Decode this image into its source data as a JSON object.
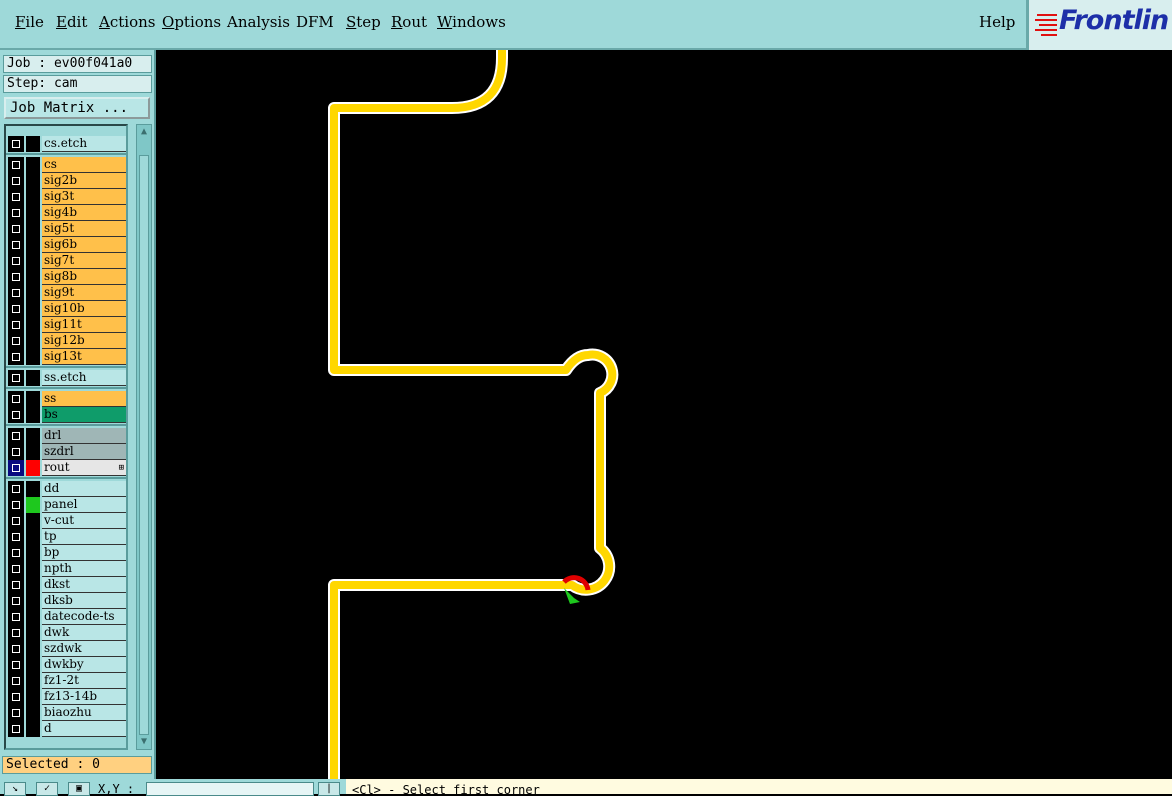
{
  "menubar": {
    "items": [
      "File",
      "Edit",
      "Actions",
      "Options",
      "Analysis",
      "DFM",
      "Step",
      "Rout",
      "Windows"
    ],
    "underline": [
      "F",
      "E",
      "A",
      "O",
      "",
      "",
      "S",
      "R",
      "W"
    ],
    "help": "Help",
    "logo": "Frontlin"
  },
  "job": {
    "job_label": "Job : ev00f041a0",
    "step_label": "Step: cam",
    "matrix_button": "Job Matrix ..."
  },
  "layers": [
    {
      "name": "cs.etch",
      "color": "#b9e6e6",
      "group": 1
    },
    {
      "name": "cs",
      "color": "#ffc04a",
      "group": 2
    },
    {
      "name": "sig2b",
      "color": "#ffc04a",
      "group": 2
    },
    {
      "name": "sig3t",
      "color": "#ffc04a",
      "group": 2
    },
    {
      "name": "sig4b",
      "color": "#ffc04a",
      "group": 2
    },
    {
      "name": "sig5t",
      "color": "#ffc04a",
      "group": 2
    },
    {
      "name": "sig6b",
      "color": "#ffc04a",
      "group": 2
    },
    {
      "name": "sig7t",
      "color": "#ffc04a",
      "group": 2
    },
    {
      "name": "sig8b",
      "color": "#ffc04a",
      "group": 2
    },
    {
      "name": "sig9t",
      "color": "#ffc04a",
      "group": 2
    },
    {
      "name": "sig10b",
      "color": "#ffc04a",
      "group": 2
    },
    {
      "name": "sig11t",
      "color": "#ffc04a",
      "group": 2
    },
    {
      "name": "sig12b",
      "color": "#ffc04a",
      "group": 2
    },
    {
      "name": "sig13t",
      "color": "#ffc04a",
      "group": 2
    },
    {
      "name": "ss.etch",
      "color": "#b9e6e6",
      "group": 3
    },
    {
      "name": "ss",
      "color": "#ffc04a",
      "group": 4
    },
    {
      "name": "bs",
      "color": "#0f9c6a",
      "group": 4
    },
    {
      "name": "drl",
      "color": "#9fb6b6",
      "group": 5
    },
    {
      "name": "szdrl",
      "color": "#9fb6b6",
      "group": 5
    },
    {
      "name": "rout",
      "color": "#e6e6e6",
      "group": 5,
      "active": true,
      "swatch": "#ff0000"
    },
    {
      "name": "dd",
      "color": "#b9e6e6",
      "group": 6
    },
    {
      "name": "panel",
      "color": "#b9e6e6",
      "group": 6,
      "swatch": "#1ec81e"
    },
    {
      "name": "v-cut",
      "color": "#b9e6e6",
      "group": 6
    },
    {
      "name": "tp",
      "color": "#b9e6e6",
      "group": 6
    },
    {
      "name": "bp",
      "color": "#b9e6e6",
      "group": 6
    },
    {
      "name": "npth",
      "color": "#b9e6e6",
      "group": 6
    },
    {
      "name": "dkst",
      "color": "#b9e6e6",
      "group": 6
    },
    {
      "name": "dksb",
      "color": "#b9e6e6",
      "group": 6
    },
    {
      "name": "datecode-ts",
      "color": "#b9e6e6",
      "group": 6
    },
    {
      "name": "dwk",
      "color": "#b9e6e6",
      "group": 6
    },
    {
      "name": "szdwk",
      "color": "#b9e6e6",
      "group": 6
    },
    {
      "name": "dwkby",
      "color": "#b9e6e6",
      "group": 6
    },
    {
      "name": "fz1-2t",
      "color": "#b9e6e6",
      "group": 6
    },
    {
      "name": "fz13-14b",
      "color": "#b9e6e6",
      "group": 6
    },
    {
      "name": "biaozhu",
      "color": "#b9e6e6",
      "group": 6
    },
    {
      "name": "d",
      "color": "#b9e6e6",
      "group": 6
    }
  ],
  "status": {
    "selected": "Selected : 0",
    "xy_label": "X,Y :",
    "prompt": "<Cl> - Select first corner"
  },
  "colors": {
    "trace": "#ffd700",
    "trace_outline": "#ffffff",
    "marker_red": "#e00000",
    "marker_green": "#1ec81e"
  }
}
